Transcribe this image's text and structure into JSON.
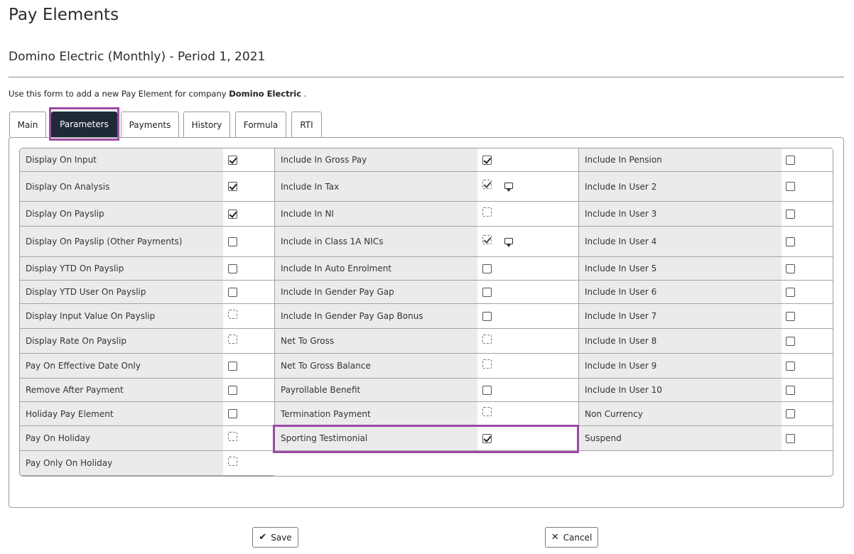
{
  "page": {
    "title": "Pay Elements",
    "subtitle": "Domino Electric (Monthly) - Period 1, 2021",
    "intro_prefix": "Use this form to add a new Pay Element for company ",
    "intro_company": "Domino Electric",
    "intro_suffix": " ."
  },
  "tabs": [
    {
      "label": "Main",
      "active": false
    },
    {
      "label": "Parameters",
      "active": true
    },
    {
      "label": "Payments",
      "active": false
    },
    {
      "label": "History",
      "active": false
    },
    {
      "label": "Formula",
      "active": false
    },
    {
      "label": "RTI",
      "active": false
    }
  ],
  "parameters": {
    "col1": [
      {
        "label": "Display On Input",
        "state": "checked"
      },
      {
        "label": "Display On Analysis",
        "state": "checked"
      },
      {
        "label": "Display On Payslip",
        "state": "checked"
      },
      {
        "label": "Display On Payslip (Other Payments)",
        "state": "unchecked"
      },
      {
        "label": "Display YTD On Payslip",
        "state": "unchecked"
      },
      {
        "label": "Display YTD User On Payslip",
        "state": "unchecked"
      },
      {
        "label": "Display Input Value On Payslip",
        "state": "disabled"
      },
      {
        "label": "Display Rate On Payslip",
        "state": "disabled"
      },
      {
        "label": "Pay On Effective Date Only",
        "state": "unchecked"
      },
      {
        "label": "Remove After Payment",
        "state": "unchecked"
      },
      {
        "label": "Holiday Pay Element",
        "state": "unchecked"
      },
      {
        "label": "Pay On Holiday",
        "state": "disabled"
      },
      {
        "label": "Pay Only On Holiday",
        "state": "disabled"
      }
    ],
    "col2": [
      {
        "label": "Include In Gross Pay",
        "state": "checked"
      },
      {
        "label": "Include In Tax",
        "state": "disabled-checked",
        "comment": true
      },
      {
        "label": "Include In NI",
        "state": "disabled"
      },
      {
        "label": "Include in Class 1A NICs",
        "state": "disabled-checked",
        "comment": true
      },
      {
        "label": "Include In Auto Enrolment",
        "state": "unchecked"
      },
      {
        "label": "Include In Gender Pay Gap",
        "state": "unchecked"
      },
      {
        "label": "Include In Gender Pay Gap Bonus",
        "state": "unchecked"
      },
      {
        "label": "Net To Gross",
        "state": "disabled"
      },
      {
        "label": "Net To Gross Balance",
        "state": "disabled"
      },
      {
        "label": "Payrollable Benefit",
        "state": "unchecked"
      },
      {
        "label": "Termination Payment",
        "state": "disabled"
      },
      {
        "label": "Sporting Testimonial",
        "state": "checked"
      }
    ],
    "col3": [
      {
        "label": "Include In Pension",
        "state": "unchecked"
      },
      {
        "label": "Include In User 2",
        "state": "unchecked"
      },
      {
        "label": "Include In User 3",
        "state": "unchecked"
      },
      {
        "label": "Include In User 4",
        "state": "unchecked"
      },
      {
        "label": "Include In User 5",
        "state": "unchecked"
      },
      {
        "label": "Include In User 6",
        "state": "unchecked"
      },
      {
        "label": "Include In User 7",
        "state": "unchecked"
      },
      {
        "label": "Include In User 8",
        "state": "unchecked"
      },
      {
        "label": "Include In User 9",
        "state": "unchecked"
      },
      {
        "label": "Include In User 10",
        "state": "unchecked"
      },
      {
        "label": "Non Currency",
        "state": "unchecked"
      },
      {
        "label": "Suspend",
        "state": "unchecked"
      }
    ]
  },
  "buttons": {
    "save": "Save",
    "cancel": "Cancel"
  },
  "icons": {
    "check": "check-icon",
    "comment": "comment-icon",
    "close": "close-icon"
  }
}
